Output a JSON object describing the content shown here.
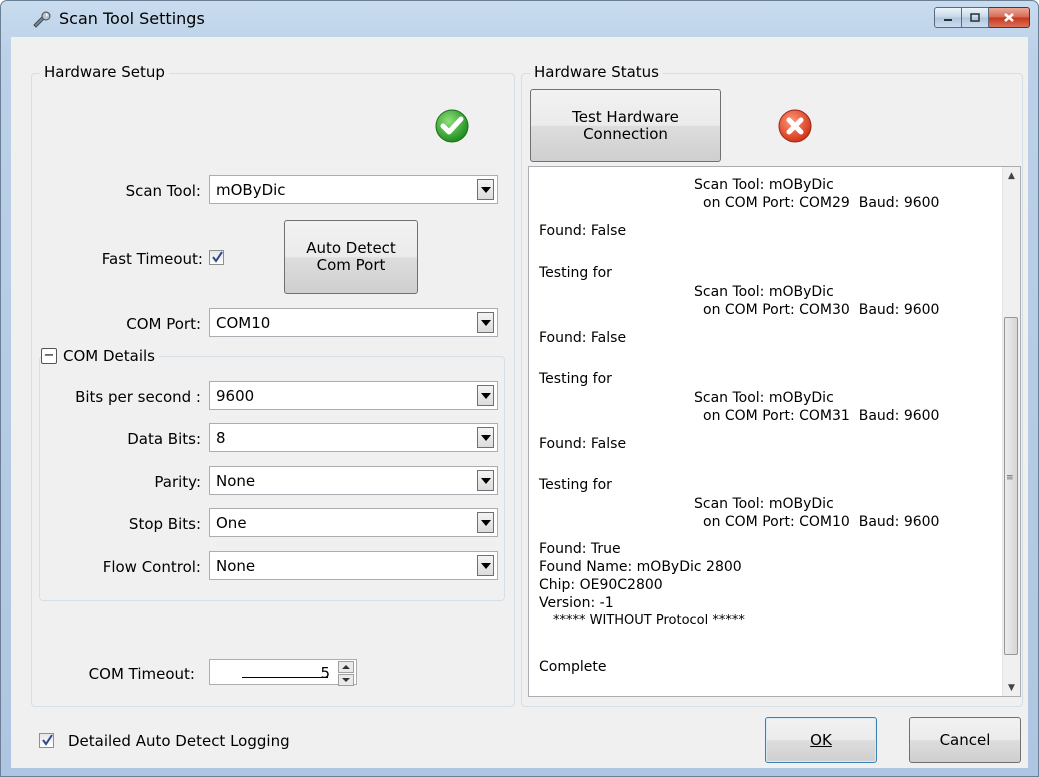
{
  "window": {
    "title": "Scan Tool Settings",
    "icon": "wrench-icon"
  },
  "hardware_setup": {
    "title": "Hardware Setup",
    "status_icon": "green-check-icon",
    "scan_tool_label": "Scan Tool:",
    "scan_tool_value": "mOByDic",
    "fast_timeout_label": "Fast Timeout:",
    "fast_timeout_checked": true,
    "auto_detect_line1": "Auto Detect",
    "auto_detect_line2": "Com Port",
    "com_port_label": "COM Port:",
    "com_port_value": "COM10",
    "com_details": {
      "title": "COM Details",
      "toggle": "−",
      "bits_label": "Bits per second :",
      "bits_value": "9600",
      "data_bits_label": "Data Bits:",
      "data_bits_value": "8",
      "parity_label": "Parity:",
      "parity_value": "None",
      "stop_bits_label": "Stop Bits:",
      "stop_bits_value": "One",
      "flow_label": "Flow Control:",
      "flow_value": "None"
    },
    "com_timeout_label": "COM Timeout:",
    "com_timeout_value": "5"
  },
  "hardware_status": {
    "title": "Hardware Status",
    "test_line1": "Test Hardware",
    "test_line2": "Connection",
    "status_icon": "red-x-icon",
    "log": [
      "Scan Tool: mOByDic",
      "on COM Port: COM29  Baud: 9600",
      "Found: False",
      "Testing for",
      "Scan Tool: mOByDic",
      "on COM Port: COM30  Baud: 9600",
      "Found: False",
      "Testing for",
      "Scan Tool: mOByDic",
      "on COM Port: COM31  Baud: 9600",
      "Found: False",
      "Testing for",
      "Scan Tool: mOByDic",
      "on COM Port: COM10  Baud: 9600",
      "Found: True",
      "Found Name: mOByDic 2800",
      "Chip: OE90C2800",
      "Version: -1",
      "***** WITHOUT Protocol *****",
      "Complete"
    ]
  },
  "footer": {
    "detailed_logging_label": "Detailed Auto Detect Logging",
    "detailed_logging_checked": true,
    "ok_label": "OK",
    "cancel_label": "Cancel"
  }
}
